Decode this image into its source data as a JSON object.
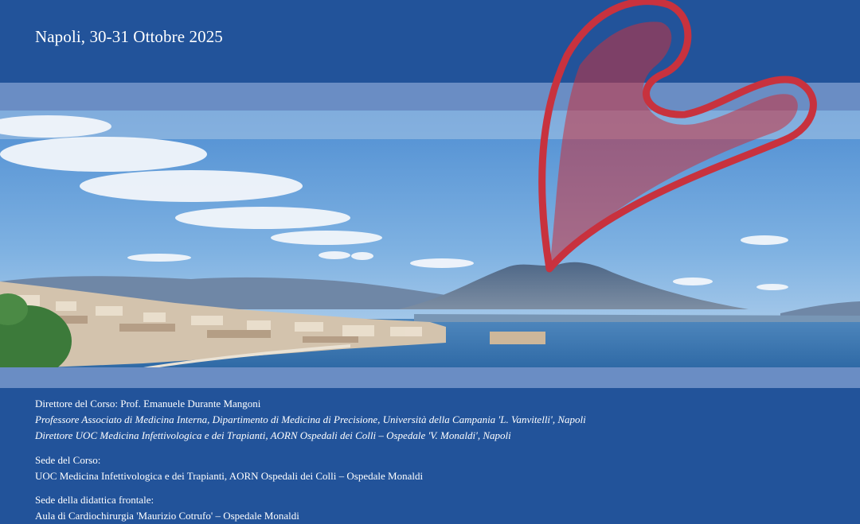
{
  "header": {
    "cut_line": "",
    "date_place": "Napoli, 30-31 Ottobre 2025"
  },
  "info": {
    "director_label": "Direttore del Corso: Prof. Emanuele Durante Mangoni",
    "director_role_1": "Professore Associato di Medicina Interna, Dipartimento di Medicina di Precisione, Università della Campania 'L. Vanvitelli', Napoli",
    "director_role_2": "Direttore UOC Medicina Infettivologica e dei Trapianti, AORN Ospedali dei Colli – Ospedale 'V. Monaldi', Napoli",
    "venue_label": "Sede del Corso:",
    "venue_value": "UOC Medicina Infettivologica e dei Trapianti, AORN Ospedali dei Colli – Ospedale Monaldi",
    "teaching_label": "Sede della didattica frontale:",
    "teaching_value": "Aula di Cardiochirurgia 'Maurizio Cotrufo' – Ospedale Monaldi"
  },
  "colors": {
    "background": "#22539a",
    "band": "#6a8dc4",
    "heart": "#c8323e"
  }
}
